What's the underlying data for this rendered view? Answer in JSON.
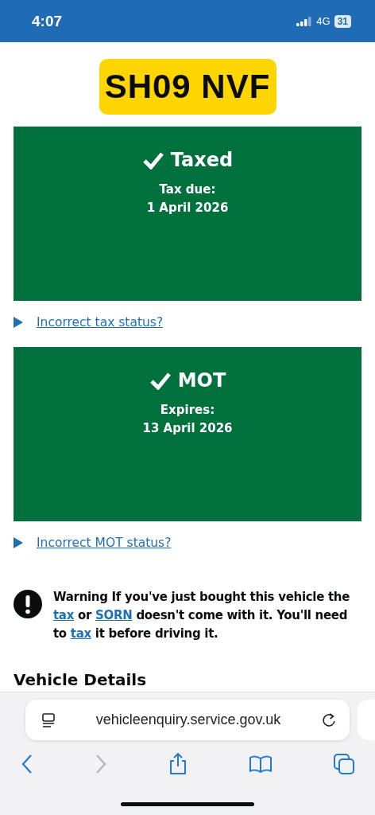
{
  "status_bar": {
    "time": "4:07",
    "network": "4G",
    "battery": "31"
  },
  "plate": "SH09 NVF",
  "panels": [
    {
      "title": "Taxed",
      "checked": true,
      "label": "Tax due:",
      "date": "1 April 2026",
      "link": "Incorrect tax status?"
    },
    {
      "title": "MOT",
      "checked": true,
      "label": "Expires:",
      "date": "13 April 2026",
      "link": "Incorrect MOT status?"
    }
  ],
  "warning": [
    {
      "kind": "text",
      "text": "Warning If you've just bought this vehicle the "
    },
    {
      "kind": "link",
      "text": "tax"
    },
    {
      "kind": "text",
      "text": " or "
    },
    {
      "kind": "link",
      "text": "SORN"
    },
    {
      "kind": "text",
      "text": " doesn't come with it. You'll need to "
    },
    {
      "kind": "link",
      "text": "tax"
    },
    {
      "kind": "text",
      "text": " it before driving it."
    }
  ],
  "section_heading": "Vehicle Details",
  "browser": {
    "url": "vehicleenquiry.service.gov.uk",
    "forward_disabled": true
  }
}
